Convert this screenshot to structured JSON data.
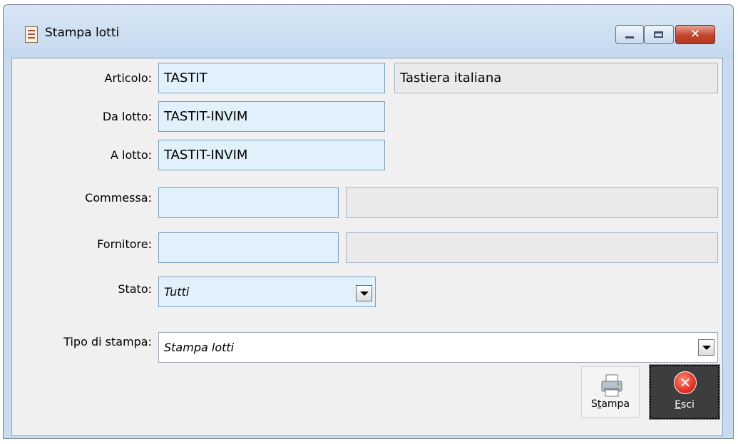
{
  "window": {
    "title": "Stampa lotti"
  },
  "form": {
    "articolo": {
      "label": "Articolo:",
      "value": "TASTIT",
      "description": "Tastiera italiana"
    },
    "da_lotto": {
      "label": "Da lotto:",
      "value": "TASTIT-INVIM"
    },
    "a_lotto": {
      "label": "A lotto:",
      "value": "TASTIT-INVIM"
    },
    "commessa": {
      "label": "Commessa:",
      "value": "",
      "description": ""
    },
    "fornitore": {
      "label": "Fornitore:",
      "value": "",
      "description": ""
    },
    "stato": {
      "label": "Stato:",
      "value": "Tutti"
    },
    "tipo_di_stampa": {
      "label": "Tipo di stampa:",
      "value": "Stampa lotti"
    }
  },
  "buttons": {
    "stampa": {
      "label_prefix": "S",
      "label_accel": "t",
      "label_suffix": "ampa"
    },
    "esci": {
      "label_accel": "E",
      "label_suffix": "sci"
    }
  }
}
